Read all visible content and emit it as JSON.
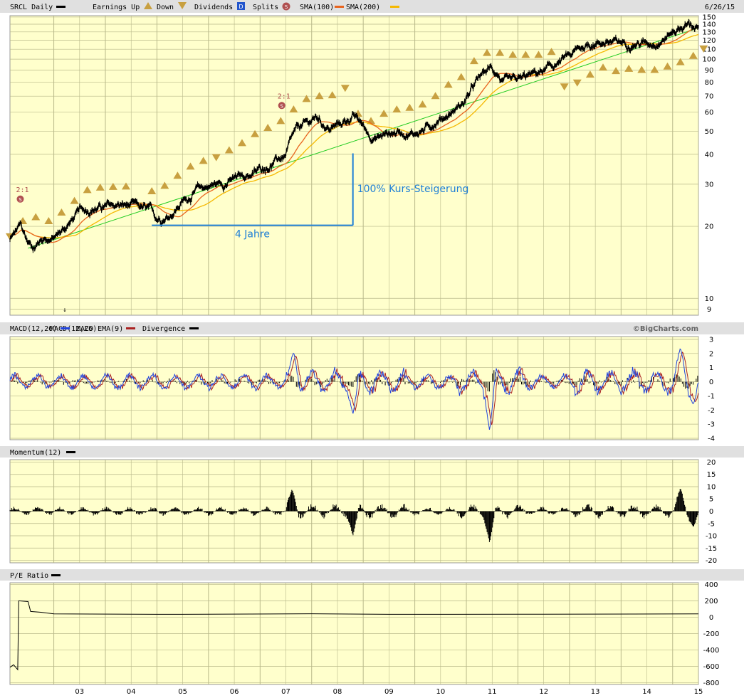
{
  "header": {
    "ticker_label": "SRCL Daily",
    "earnings_up_label": "Earnings Up",
    "down_label": "Down",
    "dividends_label": "Dividends",
    "dividends_glyph": "D",
    "splits_label": "Splits",
    "splits_glyph": "S",
    "sma100_label": "SMA(100)",
    "sma200_label": "SMA(200)",
    "date": "6/26/15"
  },
  "colors": {
    "panel_bg": "#ffffcc",
    "bar_bg": "#e0e0e0",
    "grid": "#b9b98a",
    "price": "#000000",
    "sma100": "#e8641e",
    "sma200": "#f5b800",
    "trendline": "#22cc22",
    "annotation": "#1e7fd6",
    "earnings_marker": "#c8a040",
    "split_marker": "#b05050",
    "macd": "#2244dd",
    "macd_ema": "#aa2222"
  },
  "chart_data": [
    {
      "type": "line",
      "title": "SRCL Daily",
      "y_scale": "log",
      "ylim": [
        8.5,
        152
      ],
      "y_ticks": [
        9,
        10,
        20,
        30,
        40,
        50,
        60,
        70,
        80,
        90,
        100,
        110,
        120,
        130,
        140,
        150
      ],
      "x_range": [
        2002.15,
        2015.5
      ],
      "x_ticks": [
        "03",
        "04",
        "05",
        "06",
        "07",
        "08",
        "09",
        "10",
        "11",
        "12",
        "13",
        "14",
        "15"
      ],
      "x_tick_years": [
        2003,
        2004,
        2005,
        2006,
        2007,
        2008,
        2009,
        2010,
        2011,
        2012,
        2013,
        2014,
        2015
      ],
      "series": [
        {
          "name": "SRCL",
          "anchors": [
            [
              2002.15,
              17.5
            ],
            [
              2002.35,
              20
            ],
            [
              2002.5,
              17
            ],
            [
              2002.62,
              16.5
            ],
            [
              2002.8,
              18
            ],
            [
              2003.0,
              17.8
            ],
            [
              2003.2,
              19.5
            ],
            [
              2003.5,
              23
            ],
            [
              2003.75,
              24
            ],
            [
              2004.0,
              24
            ],
            [
              2004.25,
              24.5
            ],
            [
              2004.6,
              24
            ],
            [
              2004.85,
              23
            ],
            [
              2005.0,
              21.5
            ],
            [
              2005.25,
              22.5
            ],
            [
              2005.5,
              25.5
            ],
            [
              2005.8,
              28.5
            ],
            [
              2006.0,
              29.5
            ],
            [
              2006.3,
              30.5
            ],
            [
              2006.6,
              32
            ],
            [
              2006.9,
              33.5
            ],
            [
              2007.25,
              37
            ],
            [
              2007.5,
              39.5
            ],
            [
              2007.62,
              46
            ],
            [
              2007.75,
              51
            ],
            [
              2007.95,
              54
            ],
            [
              2008.1,
              57
            ],
            [
              2008.35,
              51
            ],
            [
              2008.6,
              54
            ],
            [
              2008.8,
              58
            ],
            [
              2008.95,
              54
            ],
            [
              2009.1,
              49
            ],
            [
              2009.25,
              47
            ],
            [
              2009.5,
              49
            ],
            [
              2009.75,
              50
            ],
            [
              2009.95,
              49
            ],
            [
              2010.2,
              51
            ],
            [
              2010.45,
              56
            ],
            [
              2010.7,
              60
            ],
            [
              2010.95,
              66
            ],
            [
              2011.1,
              74
            ],
            [
              2011.3,
              85
            ],
            [
              2011.45,
              91
            ],
            [
              2011.6,
              88
            ],
            [
              2011.7,
              80
            ],
            [
              2011.85,
              78
            ],
            [
              2012.0,
              80
            ],
            [
              2012.2,
              84
            ],
            [
              2012.45,
              88
            ],
            [
              2012.65,
              92
            ],
            [
              2012.85,
              98
            ],
            [
              2013.05,
              104
            ],
            [
              2013.25,
              112
            ],
            [
              2013.45,
              117
            ],
            [
              2013.7,
              119
            ],
            [
              2013.95,
              116
            ],
            [
              2014.2,
              118
            ],
            [
              2014.5,
              117
            ],
            [
              2014.75,
              121
            ],
            [
              2014.95,
              128
            ],
            [
              2015.1,
              135
            ],
            [
              2015.3,
              140
            ],
            [
              2015.45,
              137
            ],
            [
              2015.5,
              134
            ]
          ]
        },
        {
          "name": "SMA(100)"
        },
        {
          "name": "SMA(200)"
        }
      ],
      "trendline": [
        [
          2002.5,
          16.2
        ],
        [
          2015.5,
          135
        ]
      ],
      "annotations": [
        {
          "text": "4 Jahre",
          "from": [
            2004.9,
            20.2
          ],
          "to": [
            2008.8,
            20.2
          ]
        },
        {
          "text": "100% Kurs-Steigerung",
          "from": [
            2008.8,
            20.2
          ],
          "to": [
            2008.8,
            40.4
          ]
        }
      ],
      "split_markers": [
        {
          "x": 2002.35,
          "y": 26,
          "label": "2:1"
        },
        {
          "x": 2007.42,
          "y": 64,
          "label": "2:1"
        }
      ],
      "earnings_markers": [
        [
          2002.15,
          18.2,
          "down"
        ],
        [
          2002.4,
          21,
          "up"
        ],
        [
          2002.65,
          21.8,
          "up"
        ],
        [
          2002.9,
          21,
          "up"
        ],
        [
          2003.15,
          22.8,
          "up"
        ],
        [
          2003.4,
          25.5,
          "up"
        ],
        [
          2003.65,
          28.3,
          "up"
        ],
        [
          2003.9,
          29,
          "up"
        ],
        [
          2004.15,
          29.2,
          "up"
        ],
        [
          2004.4,
          29.3,
          "up"
        ],
        [
          2004.65,
          24.5,
          "down"
        ],
        [
          2004.9,
          28,
          "up"
        ],
        [
          2005.15,
          29.5,
          "up"
        ],
        [
          2005.4,
          32.5,
          "up"
        ],
        [
          2005.65,
          35.5,
          "up"
        ],
        [
          2005.9,
          37.5,
          "up"
        ],
        [
          2006.15,
          39,
          "down"
        ],
        [
          2006.4,
          41.5,
          "up"
        ],
        [
          2006.65,
          44.5,
          "up"
        ],
        [
          2006.9,
          48.5,
          "up"
        ],
        [
          2007.15,
          51.5,
          "up"
        ],
        [
          2007.4,
          55,
          "up"
        ],
        [
          2007.65,
          61.5,
          "up"
        ],
        [
          2007.9,
          68,
          "up"
        ],
        [
          2008.15,
          70,
          "up"
        ],
        [
          2008.4,
          70.5,
          "up"
        ],
        [
          2008.65,
          76,
          "down"
        ],
        [
          2008.9,
          59,
          "up"
        ],
        [
          2009.15,
          55,
          "up"
        ],
        [
          2009.4,
          59,
          "up"
        ],
        [
          2009.65,
          61.5,
          "up"
        ],
        [
          2009.9,
          62.5,
          "up"
        ],
        [
          2010.15,
          64.5,
          "up"
        ],
        [
          2010.4,
          70,
          "up"
        ],
        [
          2010.65,
          78,
          "up"
        ],
        [
          2010.9,
          84,
          "up"
        ],
        [
          2011.15,
          98,
          "up"
        ],
        [
          2011.4,
          106,
          "up"
        ],
        [
          2011.65,
          106,
          "up"
        ],
        [
          2011.9,
          104,
          "up"
        ],
        [
          2012.15,
          104,
          "up"
        ],
        [
          2012.4,
          104,
          "up"
        ],
        [
          2012.65,
          107,
          "up"
        ],
        [
          2012.9,
          77,
          "down"
        ],
        [
          2013.15,
          80,
          "down"
        ],
        [
          2013.4,
          86,
          "up"
        ],
        [
          2013.65,
          92,
          "up"
        ],
        [
          2013.9,
          89,
          "up"
        ],
        [
          2014.15,
          91,
          "up"
        ],
        [
          2014.4,
          90,
          "up"
        ],
        [
          2014.65,
          90,
          "up"
        ],
        [
          2014.9,
          93,
          "up"
        ],
        [
          2015.15,
          97,
          "up"
        ],
        [
          2015.4,
          103,
          "up"
        ],
        [
          2015.6,
          111,
          "down"
        ]
      ]
    },
    {
      "type": "line",
      "title": "MACD(12,26)",
      "series": [
        {
          "name": "MACD(12,26)"
        },
        {
          "name": "MACD EMA(9)"
        },
        {
          "name": "Divergence"
        }
      ],
      "ylim": [
        -4.1,
        3.2
      ],
      "y_ticks": [
        3,
        2,
        1,
        0,
        -1,
        -2,
        -3,
        -4
      ],
      "spikes": [
        [
          2007.65,
          2.1
        ],
        [
          2008.8,
          -2.3
        ],
        [
          2011.45,
          -3.5
        ],
        [
          2015.15,
          2.4
        ],
        [
          2015.4,
          -1.6
        ]
      ]
    },
    {
      "type": "bar",
      "title": "Momentum(12)",
      "series": [
        {
          "name": "Momentum(12)"
        }
      ],
      "ylim": [
        -21,
        21
      ],
      "y_ticks": [
        20,
        15,
        10,
        5,
        0,
        -5,
        -10,
        -15,
        -20
      ],
      "spikes": [
        [
          2007.62,
          9
        ],
        [
          2008.8,
          -10
        ],
        [
          2011.45,
          -13
        ],
        [
          2015.15,
          9.5
        ],
        [
          2015.4,
          -6.5
        ]
      ]
    },
    {
      "type": "line",
      "title": "P/E Ratio",
      "series": [
        {
          "name": "P/E Ratio"
        }
      ],
      "ylim": [
        -820,
        420
      ],
      "y_ticks": [
        400,
        200,
        0,
        -200,
        -400,
        -600,
        -800
      ],
      "anchors": [
        [
          2002.15,
          -610
        ],
        [
          2002.22,
          -580
        ],
        [
          2002.3,
          -640
        ],
        [
          2002.32,
          200
        ],
        [
          2002.5,
          190
        ],
        [
          2002.55,
          70
        ],
        [
          2002.75,
          60
        ],
        [
          2003.0,
          40
        ],
        [
          2005.0,
          35
        ],
        [
          2006.0,
          36
        ],
        [
          2008.0,
          42
        ],
        [
          2009.5,
          35
        ],
        [
          2012.0,
          36
        ],
        [
          2015.5,
          40
        ]
      ]
    }
  ],
  "footer": {
    "watermark": "©BigCharts.com"
  }
}
